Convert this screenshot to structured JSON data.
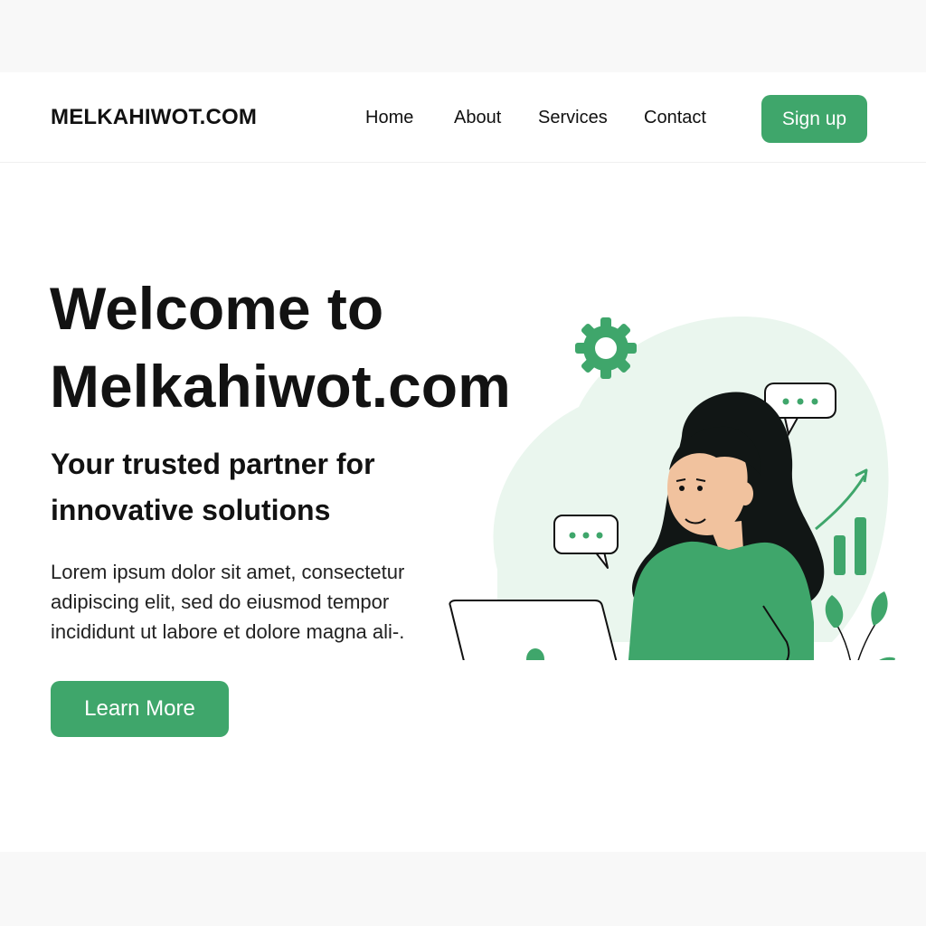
{
  "header": {
    "brand": "MELKAHIWOT.COM",
    "nav": [
      {
        "label": "Home"
      },
      {
        "label": "About"
      },
      {
        "label": "Services"
      },
      {
        "label": "Contact"
      }
    ],
    "signup_label": "Sign up"
  },
  "hero": {
    "title_line1": "Welcome to",
    "title_line2": "Melkahiwot.com",
    "subtitle_line1": "Your trusted partner for",
    "subtitle_line2": "innovative solutions",
    "body_line1": "Lorem ipsum dolor sit amet, consectetur",
    "body_line2": "adipiscing elit, sed do eiusmod tempor",
    "body_line3": "incididunt ut labore et dolore magna ali-.",
    "cta_label": "Learn More"
  },
  "illustration": {
    "icons": [
      "gear-icon",
      "chat-bubble-icon",
      "growth-chart-icon",
      "laptop-icon",
      "plant-icon"
    ]
  },
  "colors": {
    "accent": "#3fa66b",
    "accent_light": "#eaf6ee",
    "text": "#121212",
    "background": "#ffffff",
    "outer_background": "#f8f8f8"
  }
}
